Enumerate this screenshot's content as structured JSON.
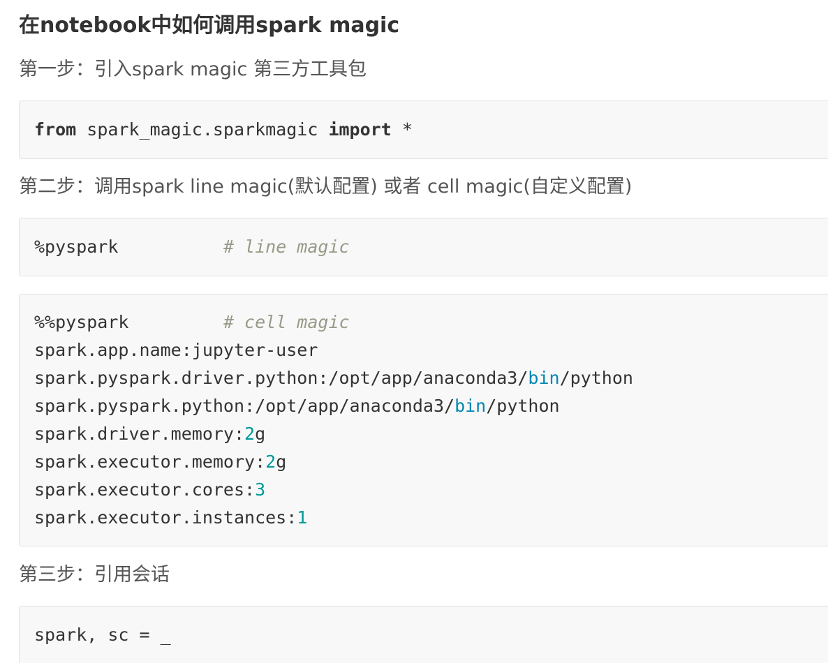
{
  "title": "在notebook中如何调用spark magic",
  "steps": [
    {
      "text": "第一步：引入spark magic 第三方工具包"
    },
    {
      "text": "第二步：调用spark line magic(默认配置) 或者 cell magic(自定义配置)"
    },
    {
      "text": "第三步：引用会话"
    }
  ],
  "code1": {
    "kw_from": "from",
    "module": " spark_magic.sparkmagic ",
    "kw_import": "import",
    "rest": " *"
  },
  "code2": {
    "magic": "%pyspark",
    "pad": "          ",
    "comment": "# line magic"
  },
  "code3": {
    "magic": "%%pyspark",
    "pad": "         ",
    "comment": "# cell magic",
    "app_name": "spark.app.name:jupyter-user",
    "driver_python_pre": "spark.pyspark.driver.python:/opt/app/anaconda3/",
    "driver_python_bin": "bin",
    "driver_python_post": "/python",
    "python_pre": "spark.pyspark.python:/opt/app/anaconda3/",
    "python_bin": "bin",
    "python_post": "/python",
    "driver_memory_key": "spark.driver.memory:",
    "driver_memory_num": "2",
    "driver_memory_unit": "g",
    "executor_memory_key": "spark.executor.memory:",
    "executor_memory_num": "2",
    "executor_memory_unit": "g",
    "executor_cores_key": "spark.executor.cores:",
    "executor_cores_num": "3",
    "executor_instances_key": "spark.executor.instances:",
    "executor_instances_num": "1"
  },
  "code4": {
    "line": "spark, sc = _"
  }
}
